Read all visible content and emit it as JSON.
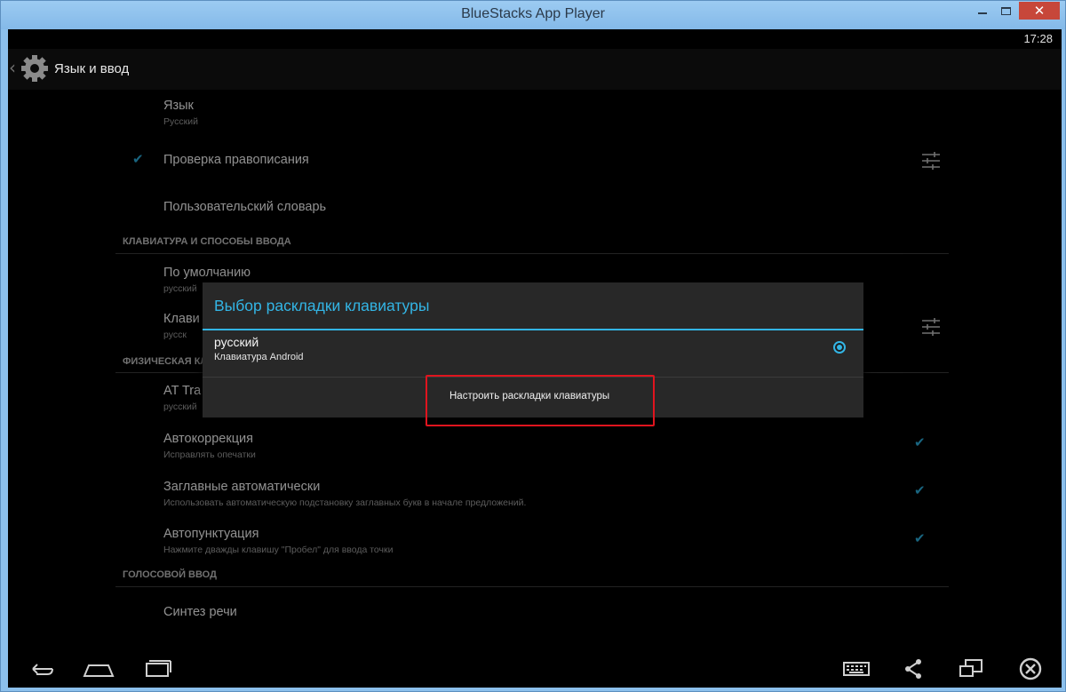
{
  "window": {
    "title": "BlueStacks App Player",
    "close_glyph": "✕"
  },
  "status_bar": {
    "time": "17:28"
  },
  "action_bar": {
    "title": "Язык и ввод",
    "icon": "settings-gear-icon"
  },
  "settings": {
    "language": {
      "title": "Язык",
      "summary": "Русский"
    },
    "spell_check": {
      "title": "Проверка правописания",
      "checked": true
    },
    "user_dictionary": {
      "title": "Пользовательский словарь"
    },
    "section_keyboard": "КЛАВИАТУРА И СПОСОБЫ ВВОДА",
    "default": {
      "title": "По умолчанию",
      "summary": "русский"
    },
    "keyboard_partial": {
      "title": "Клави",
      "summary": "русск"
    },
    "section_physical": "ФИЗИЧЕСКАЯ КЛА",
    "at_translated": {
      "title": "AT Tra",
      "summary": "русский"
    },
    "autocorrect": {
      "title": "Автокоррекция",
      "summary": "Исправлять опечатки",
      "checked": true
    },
    "autocaps": {
      "title": "Заглавные автоматически",
      "summary": "Использовать автоматическую подстановку заглавных букв в начале предложений.",
      "checked": true
    },
    "autopunct": {
      "title": "Автопунктуация",
      "summary": "Нажмите дважды клавишу \"Пробел\" для ввода точки",
      "checked": true
    },
    "section_voice": "ГОЛОСОВОЙ ВВОД",
    "tts": {
      "title": "Синтез речи"
    }
  },
  "dialog": {
    "title": "Выбор раскладки клавиатуры",
    "option": {
      "title": "русский",
      "subtitle": "Клавиатура Android",
      "selected": true
    },
    "button": "Настроить раскладки клавиатуры"
  },
  "colors": {
    "accent": "#33b5e5",
    "highlight": "#e0141e",
    "titlebar": "#8cc0ec"
  },
  "navbar": {
    "left": [
      "back-icon",
      "home-icon",
      "recent-apps-icon"
    ],
    "right": [
      "keyboard-icon",
      "share-icon",
      "multi-screen-icon",
      "exit-icon"
    ]
  }
}
